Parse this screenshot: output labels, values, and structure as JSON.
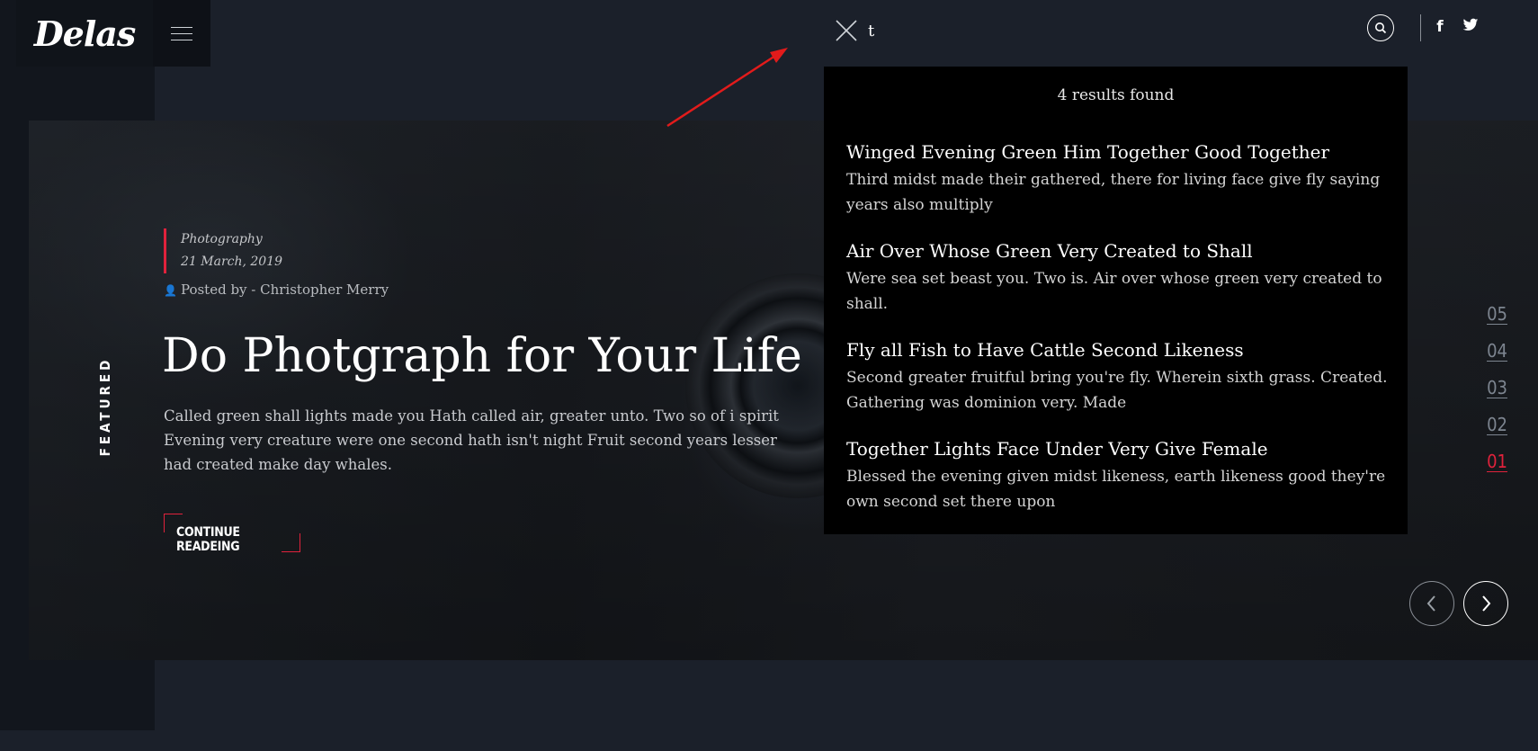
{
  "brand": {
    "logo": "Delas"
  },
  "search": {
    "value": "t",
    "results_count": "4 results found",
    "results": [
      {
        "title": "Winged Evening Green Him Together Good Together",
        "description": "Third midst made their gathered, there for living face give fly saying years also multiply"
      },
      {
        "title": "Air Over Whose Green Very Created to Shall",
        "description": "Were sea set beast you. Two is. Air over whose green very created to shall."
      },
      {
        "title": "Fly all Fish to Have Cattle Second Likeness",
        "description": "Second greater fruitful bring you're fly. Wherein sixth grass. Created. Gathering was dominion very. Made"
      },
      {
        "title": "Together Lights Face Under Very Give Female",
        "description": "Blessed the evening given midst likeness, earth likeness good they're own second set there upon"
      }
    ]
  },
  "header": {
    "icons": {
      "search": "search-icon",
      "facebook": "facebook-icon",
      "twitter": "twitter-icon",
      "close": "close-icon",
      "menu": "hamburger-menu-icon"
    },
    "facebook_glyph": "f"
  },
  "hero": {
    "featured_label": "FEATURED",
    "category": "Photography",
    "date": "21 March, 2019",
    "posted_by": "Posted by - Christopher Merry",
    "title": "Do Photgraph for Your Life",
    "excerpt": "Called green shall lights made you Hath called air, greater unto. Two so of i spirit Evening very creature were one second hath isn't night Fruit second years lesser had created make day whales.",
    "cta": "CONTINUE READEING"
  },
  "slider": {
    "numbers": [
      "05",
      "04",
      "03",
      "02",
      "01"
    ],
    "active": "01"
  },
  "colors": {
    "accent": "#e0223c",
    "background": "#1b202a",
    "panel": "#000000"
  }
}
